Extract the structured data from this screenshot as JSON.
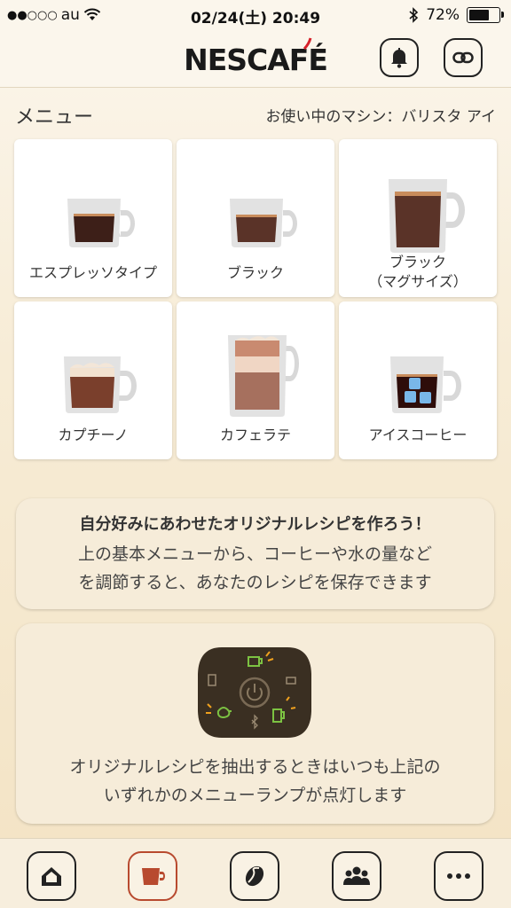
{
  "status": {
    "carrier": "au",
    "time": "02/24(土) 20:49",
    "battery": "72%",
    "battery_level": 0.72
  },
  "header": {
    "logo": "NESCAFÉ"
  },
  "menu": {
    "title": "メニュー",
    "machine": "お使い中のマシン：バリスタ アイ",
    "items": [
      {
        "label": "エスプレッソタイプ"
      },
      {
        "label": "ブラック"
      },
      {
        "label": "ブラック\n（マグサイズ）"
      },
      {
        "label": "カプチーノ"
      },
      {
        "label": "カフェラテ"
      },
      {
        "label": "アイスコーヒー"
      }
    ]
  },
  "recipe": {
    "title": "自分好みにあわせたオリジナルレシピを作ろう！",
    "line1": "上の基本メニューから、コーヒーや水の量など",
    "line2": "を調節すると、あなたのレシピを保存できます"
  },
  "machine_panel": {
    "line1": "オリジナルレシピを抽出するときはいつも上記の",
    "line2": "いずれかのメニューランプが点灯します"
  },
  "tabs": [
    {
      "icon": "home-icon"
    },
    {
      "icon": "coffee-cup-icon"
    },
    {
      "icon": "coffee-bean-icon"
    },
    {
      "icon": "community-icon"
    },
    {
      "icon": "more-icon"
    }
  ],
  "colors": {
    "accent": "#b84a2f",
    "espresso": "#3d1f18",
    "coffee": "#5a3328",
    "latte_light": "#c79a7e",
    "ice_blue": "#79b7e8",
    "lamp_green": "#7cc242",
    "lamp_orange": "#f0a11e"
  }
}
